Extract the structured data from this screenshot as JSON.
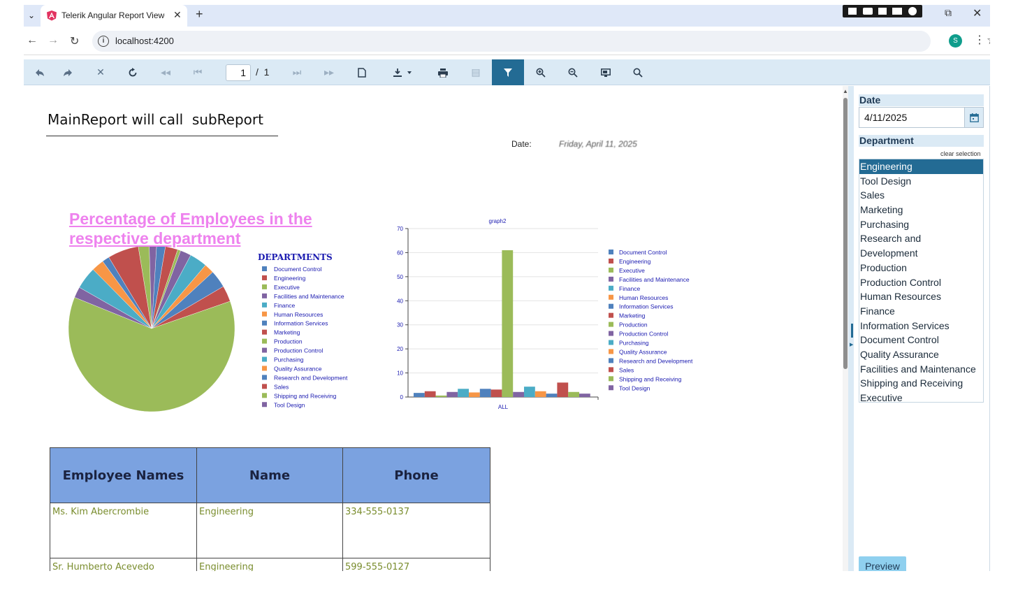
{
  "browser": {
    "tab_title": "Telerik Angular Report Viewer D",
    "url": "localhost:4200",
    "profile_initial": "S"
  },
  "toolbar": {
    "current_page": "1",
    "page_separator": "/",
    "total_pages": "1",
    "icons": [
      "back-icon",
      "forward-icon",
      "stop-icon",
      "refresh-icon",
      "first-page-icon",
      "previous-page-icon",
      "next-page-icon",
      "last-page-icon",
      "print-preview-icon",
      "export-icon",
      "print-icon",
      "document-map-icon",
      "parameters-icon",
      "zoom-in-icon",
      "zoom-out-icon",
      "toggle-zoom-icon",
      "search-icon"
    ]
  },
  "report": {
    "title": "MainReport will call  subReport",
    "date_label": "Date:",
    "date_value": "Friday, April 11, 2025",
    "pie_title": "Percentage of Employees in the respective department",
    "pie_legend_title": "DEPARTMENTS",
    "bar_title": "graph2",
    "bar_xlabel": "ALL",
    "table": {
      "headers": [
        "Employee Names",
        "Name",
        "Phone"
      ],
      "rows": [
        [
          "Ms. Kim Abercrombie",
          "Engineering",
          "334-555-0137"
        ],
        [
          "Sr. Humberto Acevedo",
          "Engineering",
          "599-555-0127"
        ]
      ]
    }
  },
  "chart_data": [
    {
      "type": "pie",
      "title": "Percentage of Employees in the respective department",
      "legend_title": "DEPARTMENTS",
      "legend_position": "right",
      "categories": [
        "Document Control",
        "Engineering",
        "Executive",
        "Facilities and Maintenance",
        "Finance",
        "Human Resources",
        "Information Services",
        "Marketing",
        "Production",
        "Production Control",
        "Purchasing",
        "Quality Assurance",
        "Research and Development",
        "Sales",
        "Shipping and Receiving",
        "Tool Design"
      ],
      "values": [
        1.7,
        2.4,
        0.6,
        2.1,
        3.4,
        1.9,
        3.4,
        3.1,
        61,
        2.1,
        4.3,
        2.4,
        1.4,
        6,
        2.1,
        1.4
      ],
      "colors": [
        "#4f81bd",
        "#c0504d",
        "#9bbb59",
        "#8064a2",
        "#4bacc6",
        "#f79646",
        "#4f81bd",
        "#c0504d",
        "#9bbb59",
        "#8064a2",
        "#4bacc6",
        "#f79646",
        "#4f81bd",
        "#c0504d",
        "#9bbb59",
        "#8064a2"
      ]
    },
    {
      "type": "bar",
      "title": "graph2",
      "xlabel": "ALL",
      "ylabel": "",
      "ylim": [
        0,
        70
      ],
      "yticks": [
        0,
        10,
        20,
        30,
        40,
        50,
        60,
        70
      ],
      "legend_position": "right",
      "categories": [
        "ALL"
      ],
      "series": [
        {
          "name": "Document Control",
          "values": [
            1.7
          ]
        },
        {
          "name": "Engineering",
          "values": [
            2.4
          ]
        },
        {
          "name": "Executive",
          "values": [
            0.6
          ]
        },
        {
          "name": "Facilities and Maintenance",
          "values": [
            2.1
          ]
        },
        {
          "name": "Finance",
          "values": [
            3.4
          ]
        },
        {
          "name": "Human Resources",
          "values": [
            1.9
          ]
        },
        {
          "name": "Information Services",
          "values": [
            3.4
          ]
        },
        {
          "name": "Marketing",
          "values": [
            3.1
          ]
        },
        {
          "name": "Production",
          "values": [
            61
          ]
        },
        {
          "name": "Production Control",
          "values": [
            2.1
          ]
        },
        {
          "name": "Purchasing",
          "values": [
            4.3
          ]
        },
        {
          "name": "Quality Assurance",
          "values": [
            2.4
          ]
        },
        {
          "name": "Research and Development",
          "values": [
            1.4
          ]
        },
        {
          "name": "Sales",
          "values": [
            6
          ]
        },
        {
          "name": "Shipping and Receiving",
          "values": [
            2.1
          ]
        },
        {
          "name": "Tool Design",
          "values": [
            1.4
          ]
        }
      ],
      "colors": [
        "#4f81bd",
        "#c0504d",
        "#9bbb59",
        "#8064a2",
        "#4bacc6",
        "#f79646",
        "#4f81bd",
        "#c0504d",
        "#9bbb59",
        "#8064a2",
        "#4bacc6",
        "#f79646",
        "#4f81bd",
        "#c0504d",
        "#9bbb59",
        "#8064a2"
      ]
    }
  ],
  "parameters": {
    "date_label": "Date",
    "date_value": "4/11/2025",
    "department_label": "Department",
    "clear_selection": "clear selection",
    "departments": [
      "Engineering",
      "Tool Design",
      "Sales",
      "Marketing",
      "Purchasing",
      "Research and Development",
      "Production",
      "Production Control",
      "Human Resources",
      "Finance",
      "Information Services",
      "Document Control",
      "Quality Assurance",
      "Facilities and Maintenance",
      "Shipping and Receiving",
      "Executive"
    ],
    "selected_department": "Engineering",
    "preview_label": "Preview"
  }
}
